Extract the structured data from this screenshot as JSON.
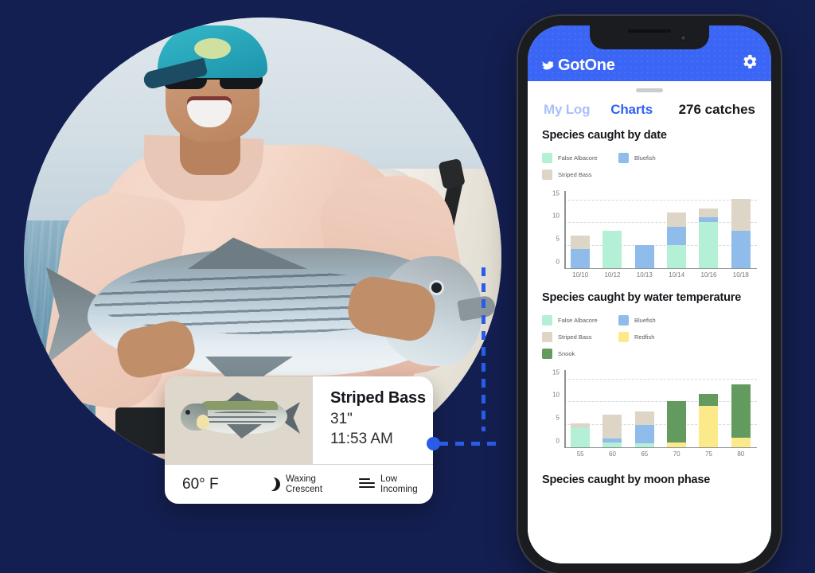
{
  "background_color": "#141f51",
  "photo": {
    "alt_description": "Angler on a boat holding a large striped bass",
    "shape": "blob-oval"
  },
  "catch_card": {
    "species": "Striped Bass",
    "length": "31\"",
    "time": "11:53 AM",
    "temperature": "60° F",
    "moon_phase_line1": "Waxing",
    "moon_phase_line2": "Crescent",
    "tide_line1": "Low",
    "tide_line2": "Incoming",
    "moon_icon": "crescent-moon-icon",
    "tide_icon": "waves-icon",
    "thumb_icon": "striped-bass-illustration"
  },
  "phone": {
    "header": {
      "brand": "GotOne",
      "brand_icon": "fish-logo-icon",
      "settings_icon": "gear-icon",
      "accent": "#3b66f5"
    },
    "tabs": [
      {
        "label": "My Log",
        "active": false
      },
      {
        "label": "Charts",
        "active": true
      }
    ],
    "catch_count": "276 catches",
    "charts": [
      {
        "title": "Species caught by date",
        "legend": [
          {
            "label": "False Albacore",
            "color": "#b3f0d5"
          },
          {
            "label": "Bluefish",
            "color": "#8fbcea"
          },
          {
            "label": "Striped Bass",
            "color": "#ddd6c6"
          }
        ]
      },
      {
        "title": "Species caught by water temperature",
        "legend": [
          {
            "label": "False Albacore",
            "color": "#b3f0d5"
          },
          {
            "label": "Bluefish",
            "color": "#8fbcea"
          },
          {
            "label": "Striped Bass",
            "color": "#ddd6c6"
          },
          {
            "label": "Redfish",
            "color": "#fbe98a"
          },
          {
            "label": "Snook",
            "color": "#639a5e"
          }
        ]
      },
      {
        "title": "Species caught by moon phase",
        "legend": []
      }
    ]
  },
  "chart_data": [
    {
      "type": "bar",
      "stacked": true,
      "title": "Species caught by date",
      "xlabel": "",
      "ylabel": "",
      "ylim": [
        0,
        17
      ],
      "yticks": [
        0,
        5,
        10,
        15
      ],
      "grid": true,
      "legend_position": "top",
      "categories": [
        "10/10",
        "10/12",
        "10/13",
        "10/14",
        "10/16",
        "10/18"
      ],
      "series": [
        {
          "name": "False Albacore",
          "color": "#b3f0d5",
          "values": [
            0,
            8,
            0,
            5,
            10,
            0
          ]
        },
        {
          "name": "Bluefish",
          "color": "#8fbcea",
          "values": [
            4,
            0,
            5,
            4,
            1,
            8
          ]
        },
        {
          "name": "Striped Bass",
          "color": "#ddd6c6",
          "values": [
            3,
            0,
            0,
            3,
            2,
            7
          ]
        }
      ],
      "totals": [
        7,
        8,
        5,
        12,
        13,
        15
      ]
    },
    {
      "type": "bar",
      "stacked": true,
      "title": "Species caught by water temperature",
      "xlabel": "",
      "ylabel": "",
      "ylim": [
        0,
        17
      ],
      "yticks": [
        0,
        5,
        10,
        15
      ],
      "grid": true,
      "legend_position": "top",
      "categories": [
        "55",
        "60",
        "65",
        "70",
        "75",
        "80"
      ],
      "series": [
        {
          "name": "False Albacore",
          "color": "#b3f0d5",
          "values": [
            4.2,
            1.0,
            0.8,
            0,
            0,
            0
          ]
        },
        {
          "name": "Bluefish",
          "color": "#8fbcea",
          "values": [
            0,
            0.8,
            4.0,
            0,
            0,
            0
          ]
        },
        {
          "name": "Striped Bass",
          "color": "#ddd6c6",
          "values": [
            1.0,
            5.3,
            3.0,
            0,
            0,
            0
          ]
        },
        {
          "name": "Redfish",
          "color": "#fbe98a",
          "values": [
            0,
            0,
            0,
            1.0,
            8.9,
            2.0
          ]
        },
        {
          "name": "Snook",
          "color": "#639a5e",
          "values": [
            0,
            0,
            0,
            9.0,
            2.7,
            11.6
          ]
        }
      ],
      "totals": [
        5.2,
        7.1,
        7.8,
        10.0,
        11.6,
        13.6
      ]
    }
  ]
}
